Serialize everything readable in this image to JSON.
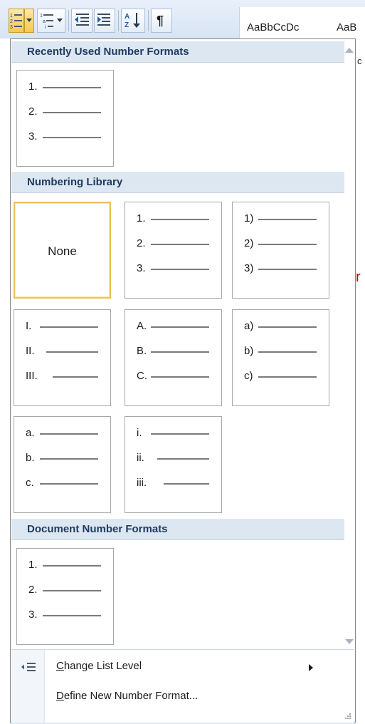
{
  "ribbon": {
    "styles_preview_1": "AaBbCcDc",
    "styles_preview_2": "AaB",
    "buttons": [
      {
        "name": "numbering-button",
        "icon": "numbering-icon"
      },
      {
        "name": "numbering-dropdown-button",
        "icon": "chevron-down-icon"
      },
      {
        "name": "multilevel-list-button",
        "icon": "multilevel-list-icon"
      },
      {
        "name": "decrease-indent-button",
        "icon": "decrease-indent-icon"
      },
      {
        "name": "increase-indent-button",
        "icon": "increase-indent-icon"
      },
      {
        "name": "sort-button",
        "icon": "sort-az-icon"
      },
      {
        "name": "show-hide-button",
        "icon": "pilcrow-icon"
      }
    ]
  },
  "menu": {
    "sections": {
      "recent": {
        "title": "Recently Used Number Formats"
      },
      "library": {
        "title": "Numbering Library"
      },
      "document": {
        "title": "Document Number Formats"
      }
    },
    "recent_tiles": [
      {
        "labels": [
          "1.",
          "2.",
          "3."
        ]
      }
    ],
    "library_tiles": [
      {
        "none_label": "None",
        "labels": []
      },
      {
        "labels": [
          "1.",
          "2.",
          "3."
        ]
      },
      {
        "labels": [
          "1)",
          "2)",
          "3)"
        ]
      },
      {
        "labels": [
          "I.",
          "II.",
          "III."
        ]
      },
      {
        "labels": [
          "A.",
          "B.",
          "C."
        ]
      },
      {
        "labels": [
          "a)",
          "b)",
          "c)"
        ]
      },
      {
        "labels": [
          "a.",
          "b.",
          "c."
        ]
      },
      {
        "labels": [
          "i.",
          "ii.",
          "iii."
        ]
      }
    ],
    "document_tiles": [
      {
        "labels": [
          "1.",
          "2.",
          "3."
        ]
      }
    ],
    "commands": {
      "change_list_level": {
        "prefix": "",
        "accel": "C",
        "rest": "hange List Level"
      },
      "define_new_number_format": {
        "prefix": "",
        "accel": "D",
        "rest": "efine New Number Format..."
      }
    }
  },
  "document": {
    "fragment_right_top": "c",
    "fragment_right_mid": "r"
  },
  "colors": {
    "selected_border": "#f0c05a",
    "section_header_bg": "#dde7f2",
    "section_header_text": "#1e3a5f",
    "accent_red": "#cc0000"
  }
}
